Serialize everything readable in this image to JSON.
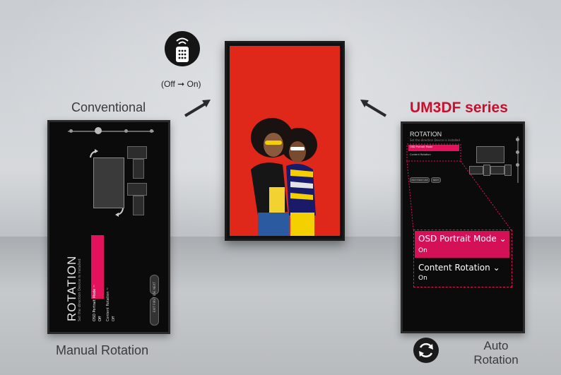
{
  "labels": {
    "conventional": "Conventional",
    "manual_rotation": "Manual Rotation",
    "series_name": "UM3DF series",
    "auto_rotation_line1": "Auto",
    "auto_rotation_line2": "Rotation",
    "remote_caption": "(Off ➞ On)"
  },
  "left_screen": {
    "title": "ROTATION",
    "subtitle": "Set the direction Device is installed",
    "osd_label": "OSD Portrait Mode ~",
    "osd_value": "Off",
    "content_label": "Content Rotation ~",
    "content_value": "Off",
    "btn_next": "NEXT",
    "btn_exit": "EXIT FIRST USE"
  },
  "right_screen": {
    "title": "ROTATION",
    "subtitle": "Set the direction Device is installed",
    "osd_label_small": "OSD Portrait Mode",
    "osd_value_small": "On",
    "content_label_small": "Content Rotation",
    "content_value_small": "On",
    "btn_exit": "EXIT FIRST USE",
    "btn_next": "NEXT",
    "zoom_osd_label": "OSD Portrait Mode",
    "zoom_osd_value": "On",
    "zoom_content_label": "Content Rotation",
    "zoom_content_value": "On"
  },
  "colors": {
    "accent": "#e4125d",
    "series_red": "#c8102e",
    "photo_bg": "#e0281a"
  },
  "icons": [
    "remote-control-icon",
    "arrow-up-right-icon",
    "arrow-up-left-icon",
    "auto-rotate-icon",
    "chevron-down-icon"
  ]
}
